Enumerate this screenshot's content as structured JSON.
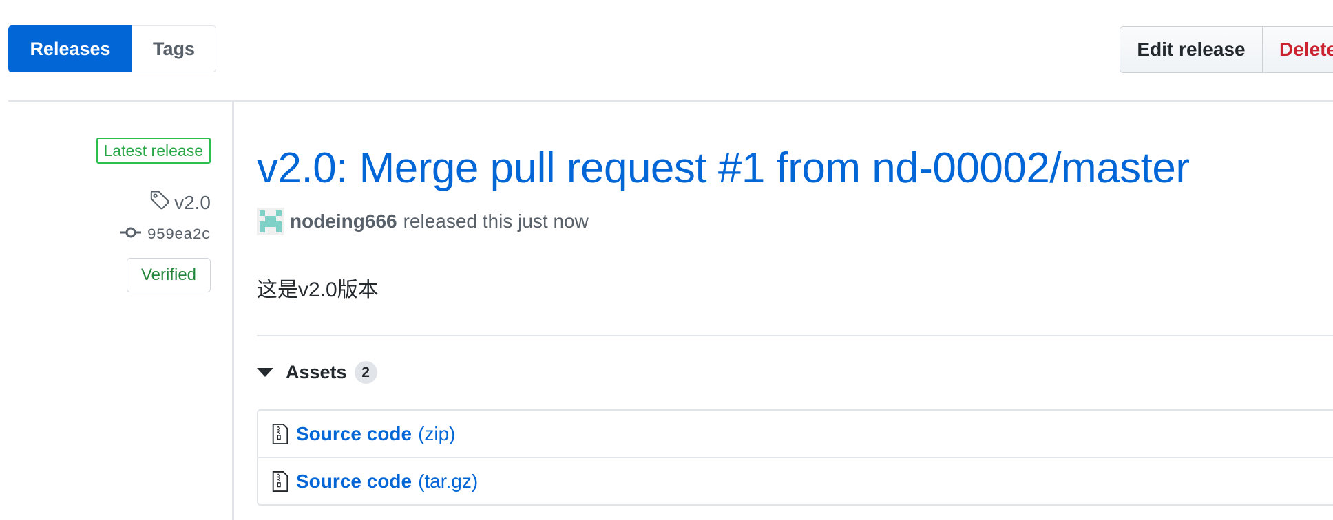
{
  "subnav": {
    "releases_label": "Releases",
    "tags_label": "Tags"
  },
  "actions": {
    "edit_label": "Edit release",
    "delete_label": "Delete"
  },
  "meta": {
    "latest_label": "Latest release",
    "tag": "v2.0",
    "commit": "959ea2c",
    "verified_label": "Verified"
  },
  "release": {
    "title": "v2.0: Merge pull request #1 from nd-00002/master",
    "author": "nodeing666",
    "byline_text": "released this just now",
    "body": "这是v2.0版本"
  },
  "assets": {
    "label": "Assets",
    "count": "2",
    "items": [
      {
        "name": "Source code",
        "ext": "(zip)"
      },
      {
        "name": "Source code",
        "ext": "(tar.gz)"
      }
    ]
  },
  "colors": {
    "primary": "#0366d6",
    "danger": "#cb2431",
    "success": "#28a745",
    "avatar": "#7fd1c7"
  },
  "icons": [
    "tag-icon",
    "commit-icon",
    "avatar-identicon",
    "caret-down-icon",
    "file-zip-icon"
  ]
}
